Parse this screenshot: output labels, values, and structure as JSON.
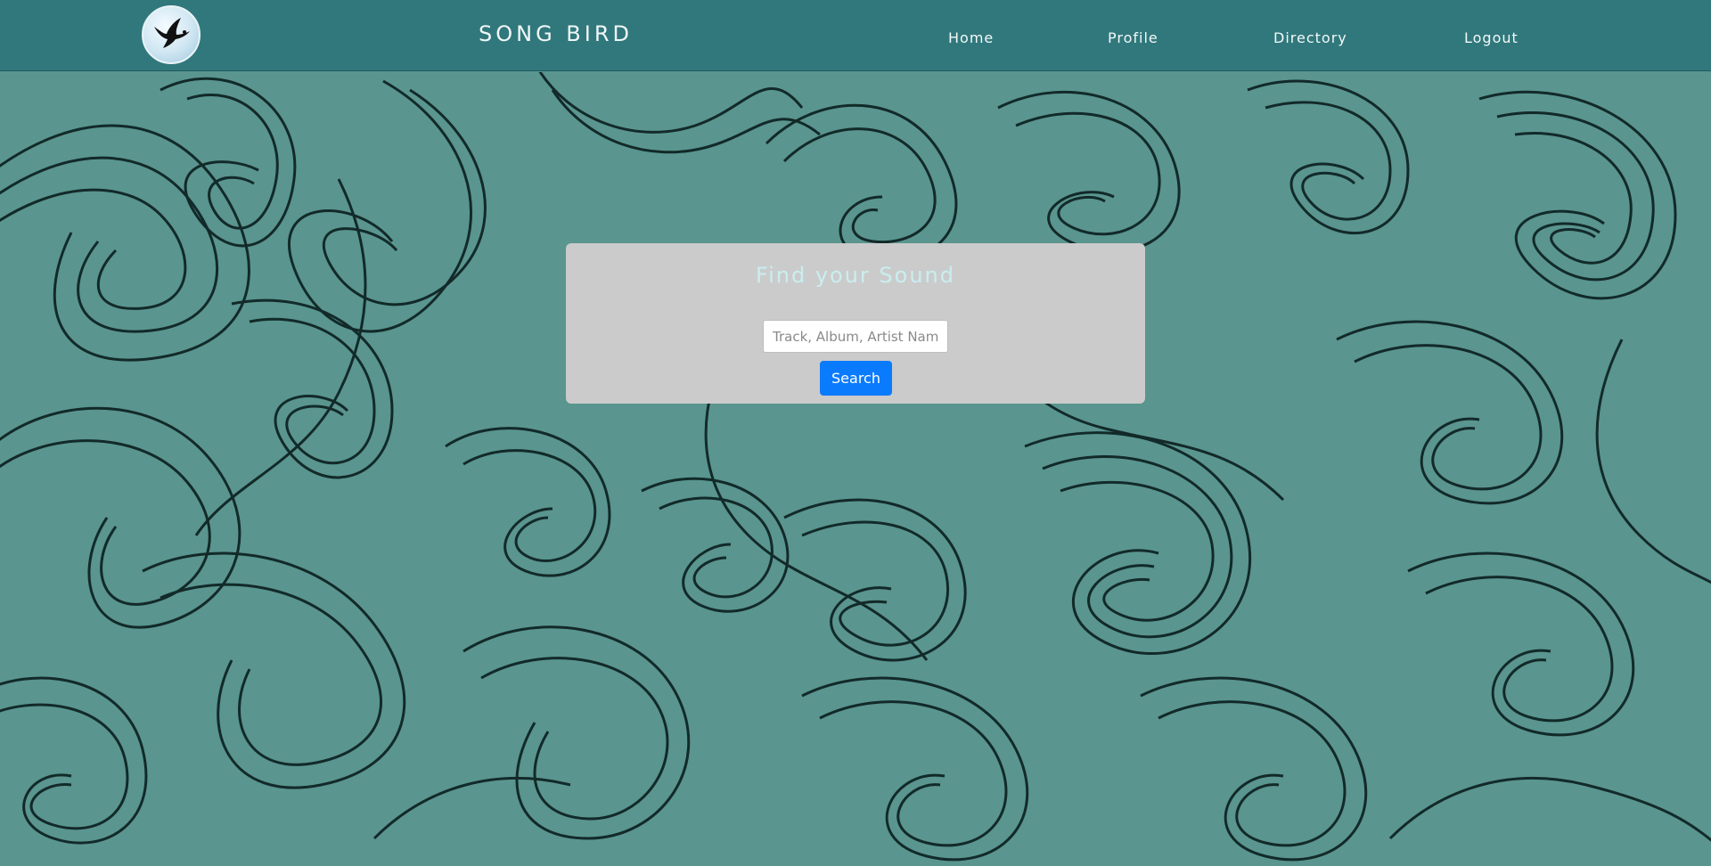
{
  "navbar": {
    "brand": "SONG BIRD",
    "logo_icon": "bird-logo-icon",
    "links": [
      {
        "label": "Home"
      },
      {
        "label": "Profile"
      },
      {
        "label": "Directory"
      },
      {
        "label": "Logout"
      }
    ],
    "background_color": "#30787c"
  },
  "search": {
    "title": "Find your Sound",
    "placeholder": "Track, Album, Artist Name",
    "value": "",
    "button_label": "Search",
    "button_color": "#0b7bfd"
  },
  "background": {
    "pattern": "teal-swirl-pattern",
    "color": "#5a958f"
  }
}
